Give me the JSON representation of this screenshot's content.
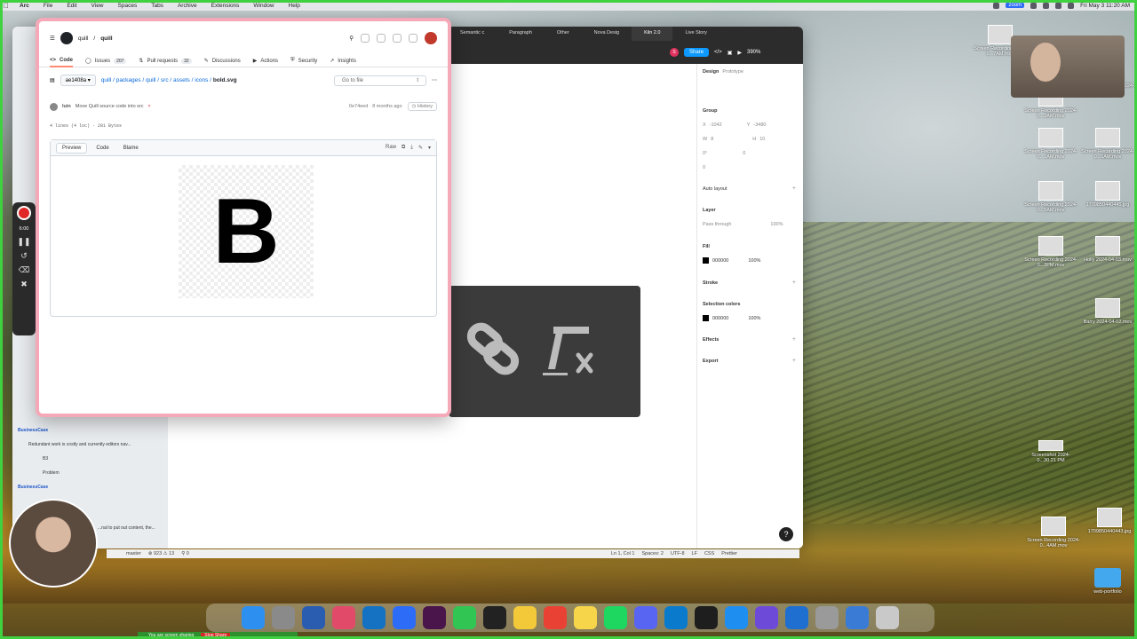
{
  "menubar": {
    "app": "Arc",
    "items": [
      "File",
      "Edit",
      "View",
      "Spaces",
      "Tabs",
      "Archive",
      "Extensions",
      "Window",
      "Help"
    ],
    "zoom_label": "zoom",
    "clock": "Fri May 3  11:20 AM"
  },
  "figma": {
    "tabs": [
      "Semantic c",
      "Paragraph",
      "Other",
      "Nova Desig",
      "Kiln 2.0",
      "Live Story"
    ],
    "share_label": "Share",
    "zoom_level": "390%",
    "avatar_initial": "S",
    "panel": {
      "tabs": [
        "Design",
        "Prototype"
      ],
      "group_label": "Group",
      "x_value": "-1042",
      "y_value": "-3480",
      "w_value": "8",
      "h_value": "10",
      "rotation": "0°",
      "radius": "0",
      "radius2": "0",
      "auto_layout": "Auto layout",
      "layer": "Layer",
      "blend": "Pass through",
      "opacity": "100%",
      "fill": "Fill",
      "fill_hex": "000000",
      "fill_opacity": "100%",
      "stroke": "Stroke",
      "selection_colors": "Selection colors",
      "sel_hex": "000000",
      "sel_opacity": "100%",
      "effects": "Effects",
      "export": "Export"
    }
  },
  "sidebar": {
    "items": [
      {
        "text": "BusinessCase",
        "heading": true
      },
      {
        "text": "Redundant work is costly and currently editors nav...",
        "heading": false
      },
      {
        "text": "B3",
        "heading": false
      },
      {
        "text": "Problem",
        "heading": false
      },
      {
        "text": "BusinessCase",
        "heading": true
      },
      {
        "text": "...nal to put out content, the...",
        "heading": false
      }
    ]
  },
  "github": {
    "repo_owner": "quill",
    "repo_name": "quill",
    "repo_sep": "/",
    "nav": [
      {
        "label": "Code",
        "count": ""
      },
      {
        "label": "Issues",
        "count": "207"
      },
      {
        "label": "Pull requests",
        "count": "32"
      },
      {
        "label": "Discussions",
        "count": ""
      },
      {
        "label": "Actions",
        "count": ""
      },
      {
        "label": "Security",
        "count": ""
      },
      {
        "label": "Insights",
        "count": ""
      }
    ],
    "branch": "ae1408a",
    "path": "quill / packages / quill / src / assets / icons /",
    "filename": "bold.svg",
    "goto_placeholder": "Go to file",
    "goto_key": "t",
    "commit_author": "luin",
    "commit_msg": "Move Quill source code into src",
    "commit_status": "×",
    "commit_meta": "0e74eed · 8 months ago",
    "history_label": "History",
    "lines_info": "4 lines (4 loc) · 281 Bytes",
    "tabs": [
      "Preview",
      "Code",
      "Blame"
    ],
    "raw_label": "Raw",
    "preview_letter": "B"
  },
  "statusbar": {
    "branch": "master",
    "diagnostics": "⊗ 923 ⚠ 13",
    "ports": "⚲ 0",
    "cursor": "Ln 1, Col 1",
    "spaces": "Spaces: 2",
    "encoding": "UTF-8",
    "eol": "LF",
    "lang": "CSS",
    "formatter": "Prettier"
  },
  "recorder": {
    "time": "6:00"
  },
  "desktop_icons": [
    {
      "label": "Screen Recording 2024-0...7AM.mov"
    },
    {
      "label": "Screen Recording 2024-0...2AM.mov"
    },
    {
      "label": "Screen Recording 2024-0...3AM.mov"
    },
    {
      "label": "Screen Recording 2024-0...1AM.mov"
    },
    {
      "label": "Screen Recording 2024-0...0AM.mov"
    },
    {
      "label": "Screen Recording 2024-0...5AM.mov"
    },
    {
      "label": "1709850440445.jpg"
    },
    {
      "label": "Screen Recording 2024-0...3PM.mov"
    },
    {
      "label": "Holly 2024-04-03.mov"
    },
    {
      "label": "Barry 2024-04-02.mov"
    },
    {
      "label": "Screenshot 2024-0...30.21 PM"
    },
    {
      "label": "Screen Recording 2024-0...4AM.mov"
    },
    {
      "label": "1709850440443.jpg"
    },
    {
      "label": "web-portfolio"
    }
  ],
  "dock": [
    "Finder",
    "Launchpad",
    "WB",
    "Arc",
    "Outlook",
    "Zoom",
    "Slack",
    "Messages",
    "Terminal",
    "Notes",
    "Chrome",
    "Stickies",
    "Spotify",
    "Discord",
    "VS Code",
    "Figma",
    "Safari",
    "Star",
    "Excel",
    "Books",
    "Pics",
    "Trash"
  ],
  "share_banner": {
    "text": "You are screen sharing",
    "stop": "Stop Share"
  },
  "help": "?"
}
